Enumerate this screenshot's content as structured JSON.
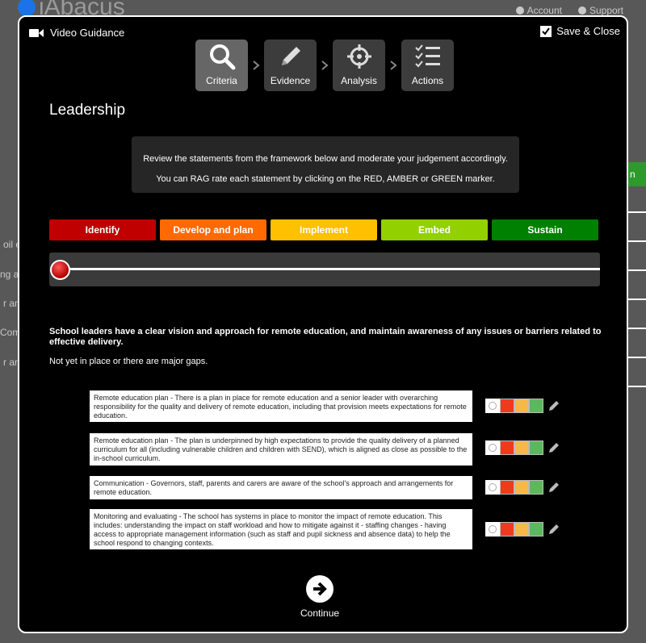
{
  "background": {
    "logo_text": "iAbacus",
    "nav": [
      "Account",
      "Support"
    ],
    "fragments": [
      "oil e",
      "ng a",
      "r and",
      "Com",
      "r and"
    ],
    "right_tab": "n"
  },
  "modal": {
    "video_guidance_label": "Video Guidance",
    "save_close_label": "Save & Close",
    "steps": [
      {
        "label": "Criteria",
        "icon": "search-icon",
        "active": true
      },
      {
        "label": "Evidence",
        "icon": "pencil-icon",
        "active": false
      },
      {
        "label": "Analysis",
        "icon": "crosshair-icon",
        "active": false
      },
      {
        "label": "Actions",
        "icon": "checklist-icon",
        "active": false
      }
    ],
    "title": "Leadership",
    "info": {
      "line1": "Review the statements from the framework below and moderate your judgement accordingly.",
      "line2": "You can RAG rate each statement by clicking on the RED, AMBER or GREEN marker."
    },
    "stages": [
      {
        "label": "Identify",
        "color": "#c00000"
      },
      {
        "label": "Develop and plan",
        "color": "#ff6a00"
      },
      {
        "label": "Implement",
        "color": "#ffc000"
      },
      {
        "label": "Embed",
        "color": "#92d000"
      },
      {
        "label": "Sustain",
        "color": "#008000"
      }
    ],
    "slider_value": 0,
    "statement": "School leaders have a clear vision and approach for remote education, and maintain awareness of any issues or barriers related to effective delivery.",
    "substatement": "Not yet in place or there are major gaps.",
    "items": [
      "Remote education plan - There is a plan in place for remote education and a senior leader with overarching responsibility for the quality and delivery of remote education, including that provision meets expectations for remote education.",
      "Remote education plan - The plan is underpinned by high expectations to provide the quality delivery of a planned curriculum for all (including vulnerable children and children with SEND), which is aligned as close as possible to the in-school curriculum.",
      "Communication - Governors, staff, parents and carers are aware of the school's approach and arrangements for remote education.",
      "Monitoring and evaluating - The school has systems in place to monitor the impact of remote education. This includes: understanding the impact on staff workload and how to mitigate against it - staffing changes - having access to appropriate management information (such as staff and pupil sickness and absence data) to help the school respond to changing contexts."
    ],
    "rag_colors": {
      "red": "#f03a1e",
      "amber": "#f5b94a",
      "green": "#5cb85c"
    },
    "continue_label": "Continue"
  }
}
